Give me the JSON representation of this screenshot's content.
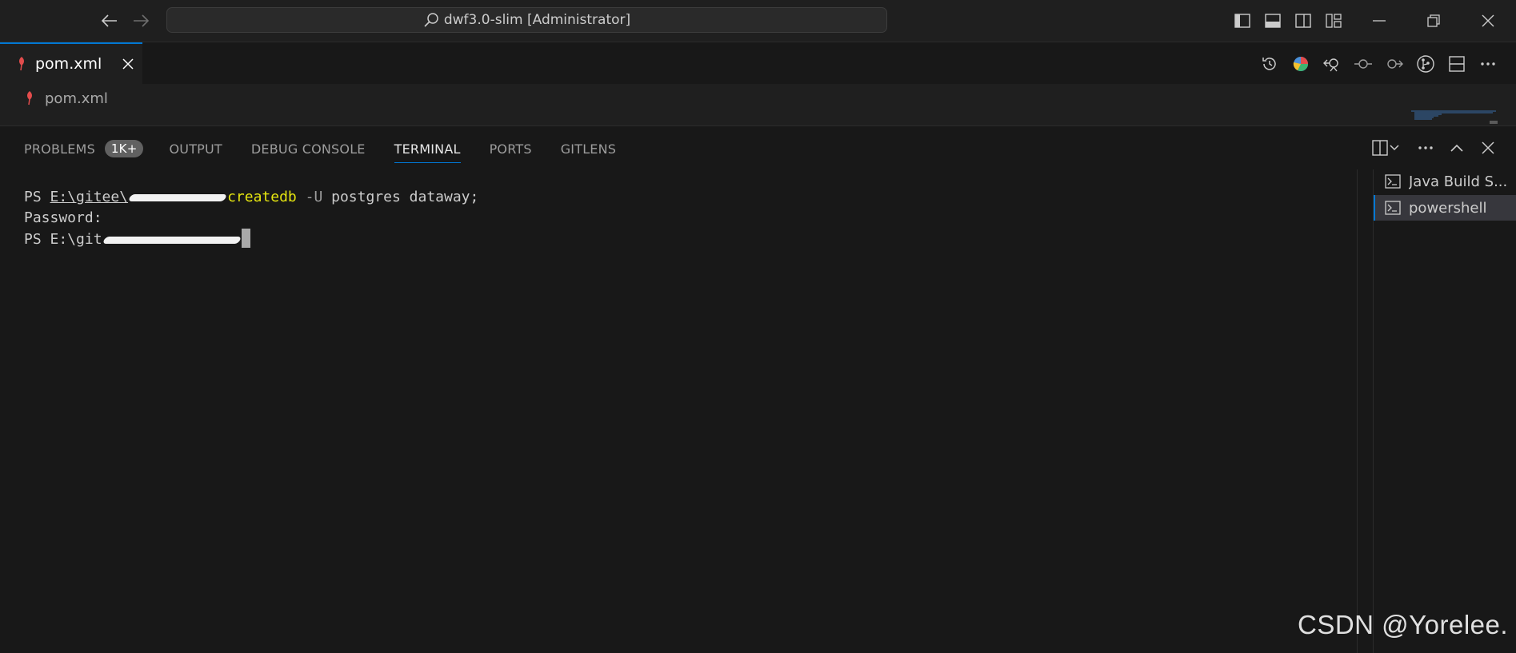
{
  "titlebar": {
    "command_center_text": "dwf3.0-slim [Administrator]",
    "icons": [
      "arrow-left-icon",
      "arrow-right-icon",
      "search-icon",
      "toggle-primary-sidebar-icon",
      "toggle-panel-icon",
      "toggle-secondary-sidebar-icon",
      "customize-layout-icon",
      "minimize-icon",
      "restore-icon",
      "close-icon"
    ]
  },
  "editor": {
    "tab_label": "pom.xml",
    "breadcrumb_file": "pom.xml",
    "actions": [
      "timeline-icon",
      "gitlens-graph-icon",
      "compare-icon",
      "previous-change-icon",
      "next-change-icon",
      "git-branch-icon",
      "split-editor-icon",
      "more-actions-icon"
    ]
  },
  "panel": {
    "tabs": [
      {
        "label": "PROBLEMS",
        "badge": "1K+"
      },
      {
        "label": "OUTPUT"
      },
      {
        "label": "DEBUG CONSOLE"
      },
      {
        "label": "TERMINAL",
        "active": true
      },
      {
        "label": "PORTS"
      },
      {
        "label": "GITLENS"
      }
    ],
    "actions": [
      "split-terminal-icon",
      "chevron-down-icon",
      "more-actions-icon",
      "maximize-panel-icon",
      "close-panel-icon"
    ]
  },
  "terminal": {
    "line1_prompt": "PS ",
    "line1_path": "E:\\gitee\\",
    "line1_cmd": "createdb",
    "line1_opt": " -U ",
    "line1_args": "postgres dataway;",
    "line2": "Password:",
    "line3_prompt": "PS E:\\git"
  },
  "terminal_list": [
    {
      "label": "Java Build S...",
      "icon": "terminal-icon"
    },
    {
      "label": "powershell",
      "icon": "terminal-icon",
      "selected": true
    }
  ],
  "watermark": "CSDN @Yorelee.",
  "colors": {
    "background": "#181818",
    "accent": "#0078d4",
    "command_yellow": "#e5e510",
    "xml_icon_red": "#e34c4c"
  }
}
